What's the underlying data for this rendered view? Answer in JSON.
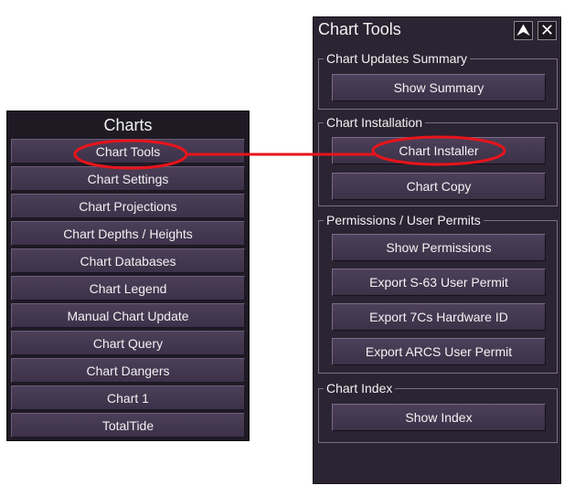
{
  "charts_menu": {
    "title": "Charts",
    "items": [
      {
        "label": "Chart Tools"
      },
      {
        "label": "Chart Settings"
      },
      {
        "label": "Chart Projections"
      },
      {
        "label": "Chart Depths / Heights"
      },
      {
        "label": "Chart Databases"
      },
      {
        "label": "Chart Legend"
      },
      {
        "label": "Manual Chart Update"
      },
      {
        "label": "Chart Query"
      },
      {
        "label": "Chart Dangers"
      },
      {
        "label": "Chart 1"
      },
      {
        "label": "TotalTide"
      }
    ]
  },
  "tools_panel": {
    "title": "Chart Tools",
    "collapse_glyph": "⮝",
    "close_glyph": "✕",
    "groups": [
      {
        "label": "Chart Updates Summary",
        "buttons": [
          {
            "label": "Show Summary"
          }
        ]
      },
      {
        "label": "Chart Installation",
        "buttons": [
          {
            "label": "Chart Installer"
          },
          {
            "label": "Chart Copy"
          }
        ]
      },
      {
        "label": "Permissions / User Permits",
        "buttons": [
          {
            "label": "Show Permissions"
          },
          {
            "label": "Export S-63 User Permit"
          },
          {
            "label": "Export 7Cs Hardware ID"
          },
          {
            "label": "Export ARCS User Permit"
          }
        ]
      },
      {
        "label": "Chart Index",
        "buttons": [
          {
            "label": "Show Index"
          }
        ]
      }
    ]
  },
  "annotation": {
    "highlight_color": "#e8141b"
  }
}
